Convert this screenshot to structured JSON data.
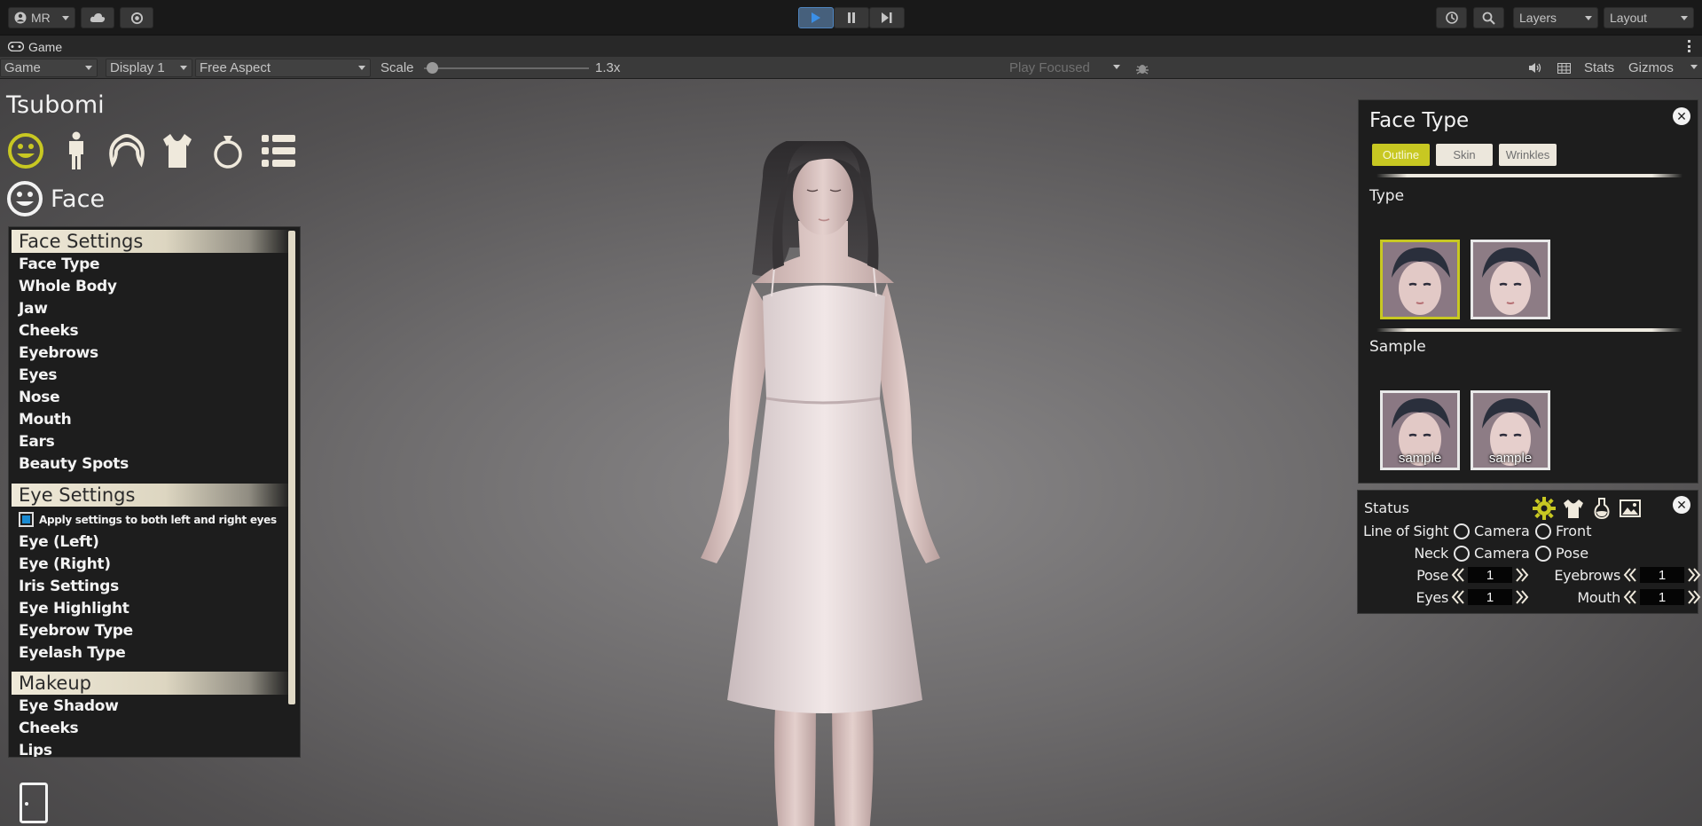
{
  "toolbar": {
    "account_label": "MR",
    "layers_label": "Layers",
    "layout_label": "Layout"
  },
  "game_tab": {
    "label": "Game"
  },
  "game_controls": {
    "view_mode": "Game",
    "display": "Display 1",
    "aspect": "Free Aspect",
    "scale_label": "Scale",
    "scale_value": 0.05,
    "scale_text": "1.3x",
    "play_mode": "Play Focused",
    "stats_label": "Stats",
    "gizmos_label": "Gizmos"
  },
  "character": {
    "name": "Tsubomi"
  },
  "categories": [
    {
      "icon": "face-icon",
      "active": true
    },
    {
      "icon": "body-icon",
      "active": false
    },
    {
      "icon": "hair-icon",
      "active": false
    },
    {
      "icon": "clothing-icon",
      "active": false
    },
    {
      "icon": "accessory-icon",
      "active": false
    },
    {
      "icon": "list-icon",
      "active": false
    }
  ],
  "section": {
    "title": "Face",
    "icon": "face-icon"
  },
  "menu": {
    "groups": [
      "Face Settings",
      "Eye Settings",
      "Makeup"
    ],
    "face_items": [
      "Face Type",
      "Whole Body",
      "Jaw",
      "Cheeks",
      "Eyebrows",
      "Eyes",
      "Nose",
      "Mouth",
      "Ears",
      "Beauty Spots"
    ],
    "apply_both_label": "Apply settings to both left and right eyes",
    "eye_items": [
      "Eye (Left)",
      "Eye (Right)",
      "Iris Settings",
      "Eye Highlight",
      "Eyebrow Type",
      "Eyelash Type"
    ],
    "makeup_items": [
      "Eye Shadow",
      "Cheeks",
      "Lips"
    ]
  },
  "face_type_panel": {
    "title": "Face Type",
    "tabs": [
      "Outline",
      "Skin",
      "Wrinkles"
    ],
    "active_tab": "Outline",
    "type_label": "Type",
    "sample_label": "Sample",
    "sample_captions": [
      "sample",
      "sample"
    ],
    "accent_color": "#c8c822"
  },
  "status_panel": {
    "title": "Status",
    "line_of_sight_label": "Line of Sight",
    "neck_label": "Neck",
    "los_options": [
      "Camera",
      "Front"
    ],
    "neck_options": [
      "Camera",
      "Pose"
    ],
    "pose_label": "Pose",
    "pose_value": "1",
    "eyes_label": "Eyes",
    "eyes_value": "1",
    "eyebrows_label": "Eyebrows",
    "eyebrows_value": "1",
    "mouth_label": "Mouth",
    "mouth_value": "1",
    "icons": [
      "gear-icon",
      "outfit-icon",
      "potion-icon",
      "image-icon"
    ]
  }
}
